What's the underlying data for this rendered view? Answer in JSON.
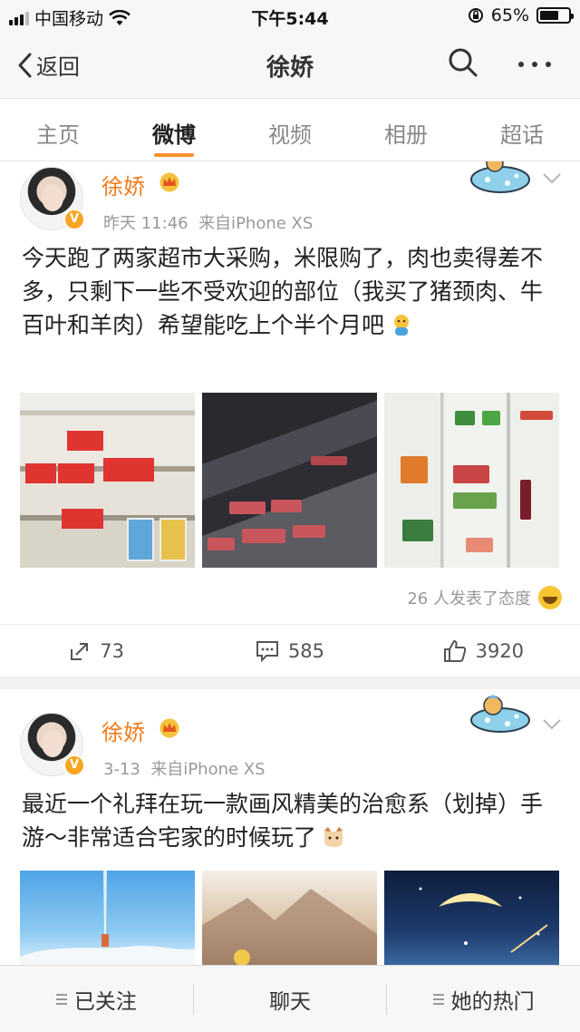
{
  "status_bar": {
    "carrier": "中国移动",
    "time": "下午5:44",
    "battery": "65%",
    "battery_level": 0.65
  },
  "nav": {
    "back_label": "返回",
    "title": "徐娇"
  },
  "tabs": [
    {
      "label": "主页"
    },
    {
      "label": "微博"
    },
    {
      "label": "视频"
    },
    {
      "label": "相册"
    },
    {
      "label": "超话"
    }
  ],
  "posts": [
    {
      "username": "徐娇",
      "time": "昨天 11:46",
      "source": "来自iPhone XS",
      "text": "今天跑了两家超市大采购，米限购了，肉也卖得差不多，只剩下一些不受欢迎的部位（我买了猪颈肉、牛百叶和羊肉）希望能吃上个半个月吧",
      "attitude": "26 人发表了态度",
      "reposts": "73",
      "comments": "585",
      "likes": "3920"
    },
    {
      "username": "徐娇",
      "time": "3-13",
      "source": "来自iPhone XS",
      "text": "最近一个礼拜在玩一款画风精美的治愈系（划掉）手游～非常适合宅家的时候玩了"
    }
  ],
  "bottom_bar": [
    {
      "label": "已关注"
    },
    {
      "label": "聊天"
    },
    {
      "label": "她的热门"
    }
  ],
  "colors": {
    "accent": "#f37b1d",
    "tab_indicator": "#f6912a"
  }
}
